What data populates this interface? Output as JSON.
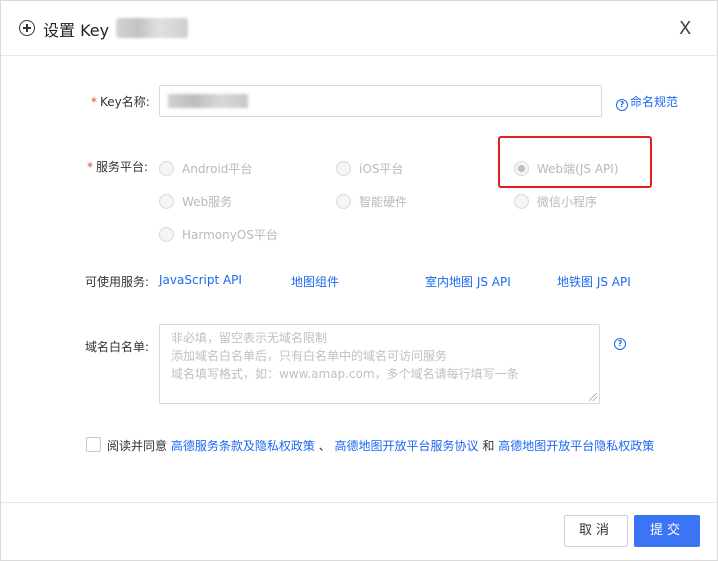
{
  "header": {
    "title": "设置 Key",
    "close": "X"
  },
  "form": {
    "key_name": {
      "required": "*",
      "label": "Key名称:",
      "help": "命名规范",
      "help_icon": "?"
    },
    "platform": {
      "required": "*",
      "label": "服务平台:",
      "options": [
        {
          "label": "Android平台",
          "checked": false
        },
        {
          "label": "iOS平台",
          "checked": false
        },
        {
          "label": "Web端(JS API)",
          "checked": true
        },
        {
          "label": "Web服务",
          "checked": false
        },
        {
          "label": "智能硬件",
          "checked": false
        },
        {
          "label": "微信小程序",
          "checked": false
        },
        {
          "label": "HarmonyOS平台",
          "checked": false
        }
      ]
    },
    "services": {
      "label": "可使用服务:",
      "items": [
        "JavaScript API",
        "地图组件",
        "室内地图 JS API",
        "地铁图 JS API"
      ]
    },
    "whitelist": {
      "label": "域名白名单:",
      "placeholder_lines": [
        "非必填，留空表示无域名限制",
        "添加域名白名单后，只有白名单中的域名可访问服务",
        "域名填写格式，如：www.amap.com，多个域名请每行填写一条"
      ],
      "help_icon": "?"
    },
    "agreement": {
      "prefix": "阅读并同意",
      "link1": "高德服务条款及隐私权政策",
      "sep": "、",
      "link2": "高德地图开放平台服务协议",
      "and": "和",
      "link3": "高德地图开放平台隐私权政策"
    }
  },
  "footer": {
    "cancel": "取消",
    "submit": "提交"
  },
  "colors": {
    "link": "#1d68f0",
    "primary": "#3b75f6",
    "highlight": "#e02020"
  }
}
